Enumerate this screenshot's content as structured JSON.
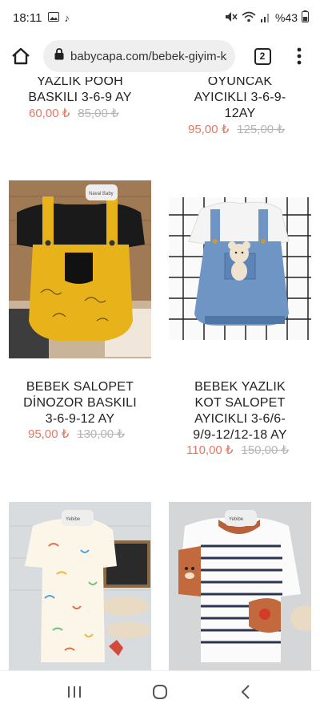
{
  "status_bar": {
    "time": "18:11",
    "icons": [
      "gallery-icon",
      "music-note-icon"
    ],
    "battery": "%43",
    "right_icons": [
      "mute-icon",
      "wifi-icon",
      "signal-icon"
    ]
  },
  "browser": {
    "url": "babycapa.com/bebek-giyim-ka",
    "tab_count": "2"
  },
  "products": [
    {
      "name_lines": [
        "YAZLIK POOH",
        "BASKILI 3-6-9 AY"
      ],
      "price": "60,00 ₺",
      "old_price": "85,00 ₺"
    },
    {
      "name_lines": [
        "OYUNCAK",
        "AYICIKLI 3-6-9-",
        "12AY"
      ],
      "price": "95,00 ₺",
      "old_price": "125,00 ₺"
    },
    {
      "name_lines": [
        "BEBEK SALOPET",
        "DİNOZOR BASKILI",
        "3-6-9-12 AY"
      ],
      "price": "95,00 ₺",
      "old_price": "130,00 ₺"
    },
    {
      "name_lines": [
        "BEBEK YAZLIK",
        "KOT SALOPET",
        "AYICIKLI 3-6/6-",
        "9/9-12/12-18 AY"
      ],
      "price": "110,00 ₺",
      "old_price": "150,00 ₺"
    }
  ],
  "images": {
    "dino_overall": "yellow-dinosaur-overall-photo",
    "denim_overall": "denim-bear-overall-photo",
    "pattern_romper": "squiggle-pattern-romper-photo",
    "striped_romper": "striped-bear-romper-photo"
  },
  "nav": [
    "recent-apps-icon",
    "home-circle-icon",
    "back-icon"
  ],
  "colors": {
    "sale": "#e57862",
    "old": "#b6b6b6"
  }
}
